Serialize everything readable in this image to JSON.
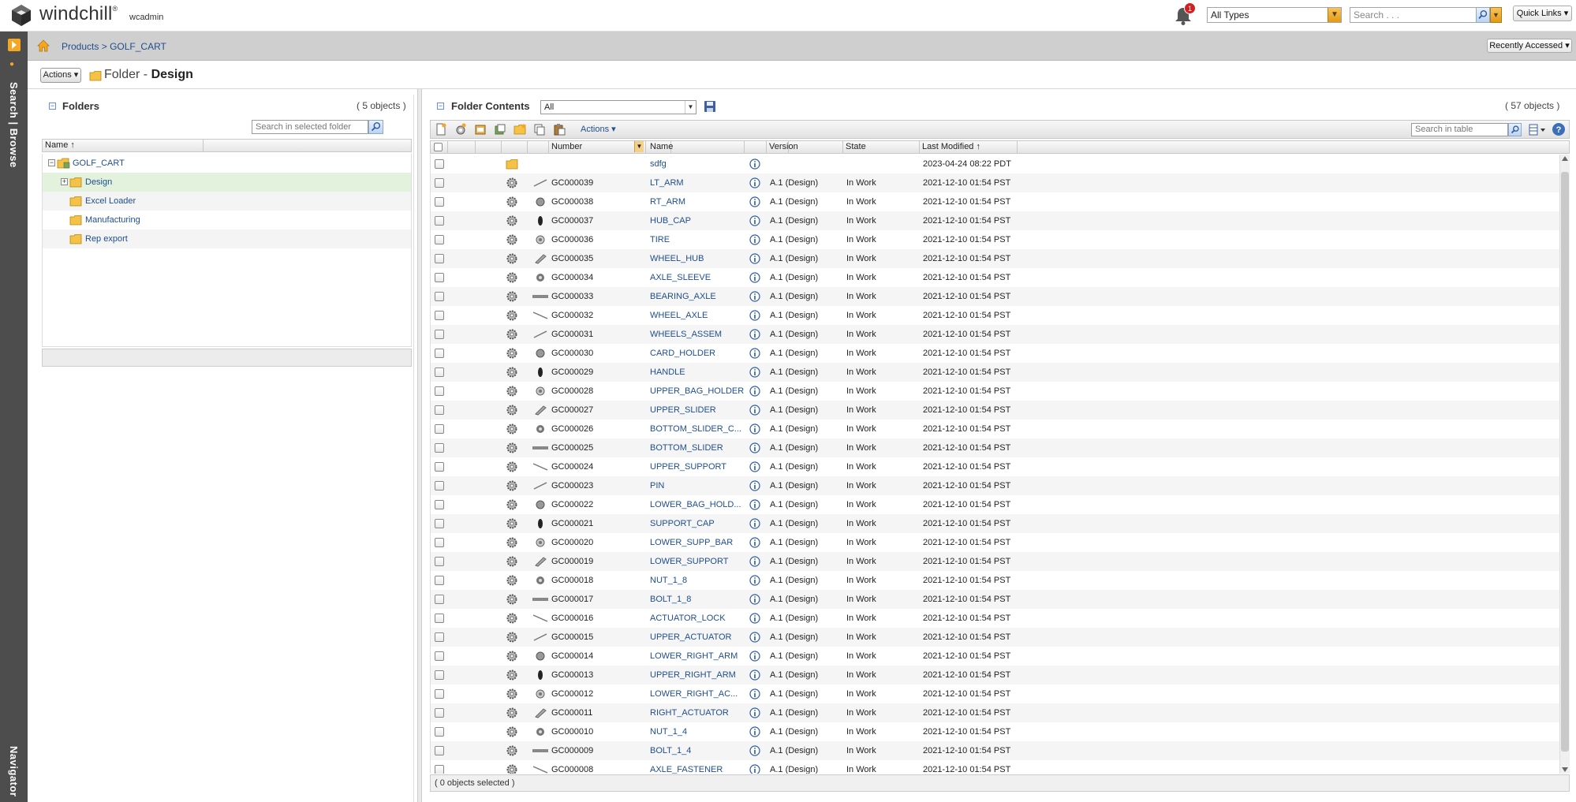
{
  "app": {
    "brand": "windchill",
    "user": "wcadmin",
    "notification_count": "1",
    "type_filter": "All Types",
    "search_placeholder": "Search . . .",
    "quick_links": "Quick Links",
    "accent_color": "#f5a623"
  },
  "nav": {
    "search_browse": "Search | Browse",
    "navigator": "Navigator"
  },
  "breadcrumb": {
    "root": "Products",
    "separator": ">",
    "current": "GOLF_CART",
    "recently_accessed": "Recently Accessed"
  },
  "title": {
    "actions": "Actions",
    "prefix": "Folder - ",
    "name": "Design"
  },
  "folders": {
    "title": "Folders",
    "count": "( 5 objects )",
    "search_placeholder": "Search in selected folder",
    "column_name": "Name",
    "items": [
      {
        "label": "GOLF_CART"
      },
      {
        "label": "Design"
      },
      {
        "label": "Excel Loader"
      },
      {
        "label": "Manufacturing"
      },
      {
        "label": "Rep export"
      }
    ]
  },
  "contents": {
    "title": "Folder Contents",
    "view": "All",
    "count": "( 57 objects )",
    "actions": "Actions",
    "search_placeholder": "Search in table",
    "columns": {
      "number": "Number",
      "name": "Name",
      "version": "Version",
      "state": "State",
      "last_modified": "Last Modified"
    },
    "footer": "( 0 objects selected )",
    "rows": [
      {
        "number": "",
        "name": "sdfg",
        "version": "",
        "state": "",
        "modified": "2023-04-24 08:22 PDT",
        "kind": "folder"
      },
      {
        "number": "GC000039",
        "name": "LT_ARM",
        "version": "A.1 (Design)",
        "state": "In Work",
        "modified": "2021-12-10 01:54 PST",
        "kind": "part"
      },
      {
        "number": "GC000038",
        "name": "RT_ARM",
        "version": "A.1 (Design)",
        "state": "In Work",
        "modified": "2021-12-10 01:54 PST",
        "kind": "part"
      },
      {
        "number": "GC000037",
        "name": "HUB_CAP",
        "version": "A.1 (Design)",
        "state": "In Work",
        "modified": "2021-12-10 01:54 PST",
        "kind": "part"
      },
      {
        "number": "GC000036",
        "name": "TIRE",
        "version": "A.1 (Design)",
        "state": "In Work",
        "modified": "2021-12-10 01:54 PST",
        "kind": "part"
      },
      {
        "number": "GC000035",
        "name": "WHEEL_HUB",
        "version": "A.1 (Design)",
        "state": "In Work",
        "modified": "2021-12-10 01:54 PST",
        "kind": "part"
      },
      {
        "number": "GC000034",
        "name": "AXLE_SLEEVE",
        "version": "A.1 (Design)",
        "state": "In Work",
        "modified": "2021-12-10 01:54 PST",
        "kind": "part"
      },
      {
        "number": "GC000033",
        "name": "BEARING_AXLE",
        "version": "A.1 (Design)",
        "state": "In Work",
        "modified": "2021-12-10 01:54 PST",
        "kind": "part"
      },
      {
        "number": "GC000032",
        "name": "WHEEL_AXLE",
        "version": "A.1 (Design)",
        "state": "In Work",
        "modified": "2021-12-10 01:54 PST",
        "kind": "part"
      },
      {
        "number": "GC000031",
        "name": "WHEELS_ASSEM",
        "version": "A.1 (Design)",
        "state": "In Work",
        "modified": "2021-12-10 01:54 PST",
        "kind": "part"
      },
      {
        "number": "GC000030",
        "name": "CARD_HOLDER",
        "version": "A.1 (Design)",
        "state": "In Work",
        "modified": "2021-12-10 01:54 PST",
        "kind": "part"
      },
      {
        "number": "GC000029",
        "name": "HANDLE",
        "version": "A.1 (Design)",
        "state": "In Work",
        "modified": "2021-12-10 01:54 PST",
        "kind": "part"
      },
      {
        "number": "GC000028",
        "name": "UPPER_BAG_HOLDER",
        "version": "A.1 (Design)",
        "state": "In Work",
        "modified": "2021-12-10 01:54 PST",
        "kind": "part"
      },
      {
        "number": "GC000027",
        "name": "UPPER_SLIDER",
        "version": "A.1 (Design)",
        "state": "In Work",
        "modified": "2021-12-10 01:54 PST",
        "kind": "part"
      },
      {
        "number": "GC000026",
        "name": "BOTTOM_SLIDER_C...",
        "version": "A.1 (Design)",
        "state": "In Work",
        "modified": "2021-12-10 01:54 PST",
        "kind": "part"
      },
      {
        "number": "GC000025",
        "name": "BOTTOM_SLIDER",
        "version": "A.1 (Design)",
        "state": "In Work",
        "modified": "2021-12-10 01:54 PST",
        "kind": "part"
      },
      {
        "number": "GC000024",
        "name": "UPPER_SUPPORT",
        "version": "A.1 (Design)",
        "state": "In Work",
        "modified": "2021-12-10 01:54 PST",
        "kind": "part"
      },
      {
        "number": "GC000023",
        "name": "PIN",
        "version": "A.1 (Design)",
        "state": "In Work",
        "modified": "2021-12-10 01:54 PST",
        "kind": "part"
      },
      {
        "number": "GC000022",
        "name": "LOWER_BAG_HOLD...",
        "version": "A.1 (Design)",
        "state": "In Work",
        "modified": "2021-12-10 01:54 PST",
        "kind": "part"
      },
      {
        "number": "GC000021",
        "name": "SUPPORT_CAP",
        "version": "A.1 (Design)",
        "state": "In Work",
        "modified": "2021-12-10 01:54 PST",
        "kind": "part"
      },
      {
        "number": "GC000020",
        "name": "LOWER_SUPP_BAR",
        "version": "A.1 (Design)",
        "state": "In Work",
        "modified": "2021-12-10 01:54 PST",
        "kind": "part"
      },
      {
        "number": "GC000019",
        "name": "LOWER_SUPPORT",
        "version": "A.1 (Design)",
        "state": "In Work",
        "modified": "2021-12-10 01:54 PST",
        "kind": "part"
      },
      {
        "number": "GC000018",
        "name": "NUT_1_8",
        "version": "A.1 (Design)",
        "state": "In Work",
        "modified": "2021-12-10 01:54 PST",
        "kind": "part"
      },
      {
        "number": "GC000017",
        "name": "BOLT_1_8",
        "version": "A.1 (Design)",
        "state": "In Work",
        "modified": "2021-12-10 01:54 PST",
        "kind": "part"
      },
      {
        "number": "GC000016",
        "name": "ACTUATOR_LOCK",
        "version": "A.1 (Design)",
        "state": "In Work",
        "modified": "2021-12-10 01:54 PST",
        "kind": "part"
      },
      {
        "number": "GC000015",
        "name": "UPPER_ACTUATOR",
        "version": "A.1 (Design)",
        "state": "In Work",
        "modified": "2021-12-10 01:54 PST",
        "kind": "part"
      },
      {
        "number": "GC000014",
        "name": "LOWER_RIGHT_ARM",
        "version": "A.1 (Design)",
        "state": "In Work",
        "modified": "2021-12-10 01:54 PST",
        "kind": "part"
      },
      {
        "number": "GC000013",
        "name": "UPPER_RIGHT_ARM",
        "version": "A.1 (Design)",
        "state": "In Work",
        "modified": "2021-12-10 01:54 PST",
        "kind": "part"
      },
      {
        "number": "GC000012",
        "name": "LOWER_RIGHT_AC...",
        "version": "A.1 (Design)",
        "state": "In Work",
        "modified": "2021-12-10 01:54 PST",
        "kind": "part"
      },
      {
        "number": "GC000011",
        "name": "RIGHT_ACTUATOR",
        "version": "A.1 (Design)",
        "state": "In Work",
        "modified": "2021-12-10 01:54 PST",
        "kind": "part"
      },
      {
        "number": "GC000010",
        "name": "NUT_1_4",
        "version": "A.1 (Design)",
        "state": "In Work",
        "modified": "2021-12-10 01:54 PST",
        "kind": "part"
      },
      {
        "number": "GC000009",
        "name": "BOLT_1_4",
        "version": "A.1 (Design)",
        "state": "In Work",
        "modified": "2021-12-10 01:54 PST",
        "kind": "part"
      },
      {
        "number": "GC000008",
        "name": "AXLE_FASTENER",
        "version": "A.1 (Design)",
        "state": "In Work",
        "modified": "2021-12-10 01:54 PST",
        "kind": "part"
      }
    ]
  }
}
